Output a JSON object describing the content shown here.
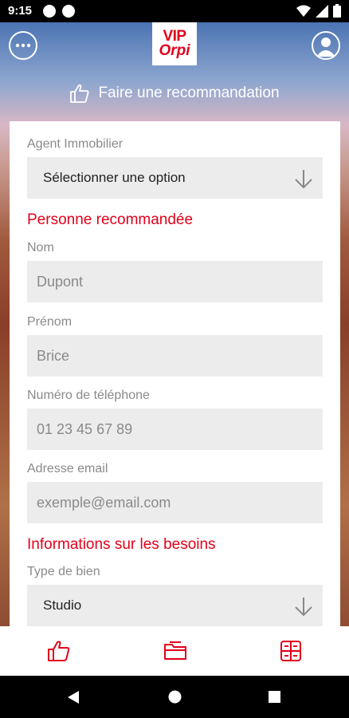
{
  "status_bar": {
    "time": "9:15"
  },
  "header": {
    "logo_top": "VIP",
    "logo_bottom": "Orpi",
    "recommend_title": "Faire une recommandation"
  },
  "form": {
    "agent_label": "Agent Immobilier",
    "agent_select": "Sélectionner une option",
    "section_person": "Personne recommandée",
    "nom_label": "Nom",
    "nom_placeholder": "Dupont",
    "prenom_label": "Prénom",
    "prenom_placeholder": "Brice",
    "phone_label": "Numéro de téléphone",
    "phone_placeholder": "01 23 45 67 89",
    "email_label": "Adresse email",
    "email_placeholder": "exemple@email.com",
    "section_needs": "Informations sur les besoins",
    "type_label": "Type de bien",
    "type_select": "Studio"
  },
  "colors": {
    "accent": "#e2001a",
    "field_bg": "#ececec"
  },
  "icons": [
    "menu-icon",
    "profile-icon",
    "thumbs-up-icon",
    "folder-icon",
    "grid-icon"
  ]
}
